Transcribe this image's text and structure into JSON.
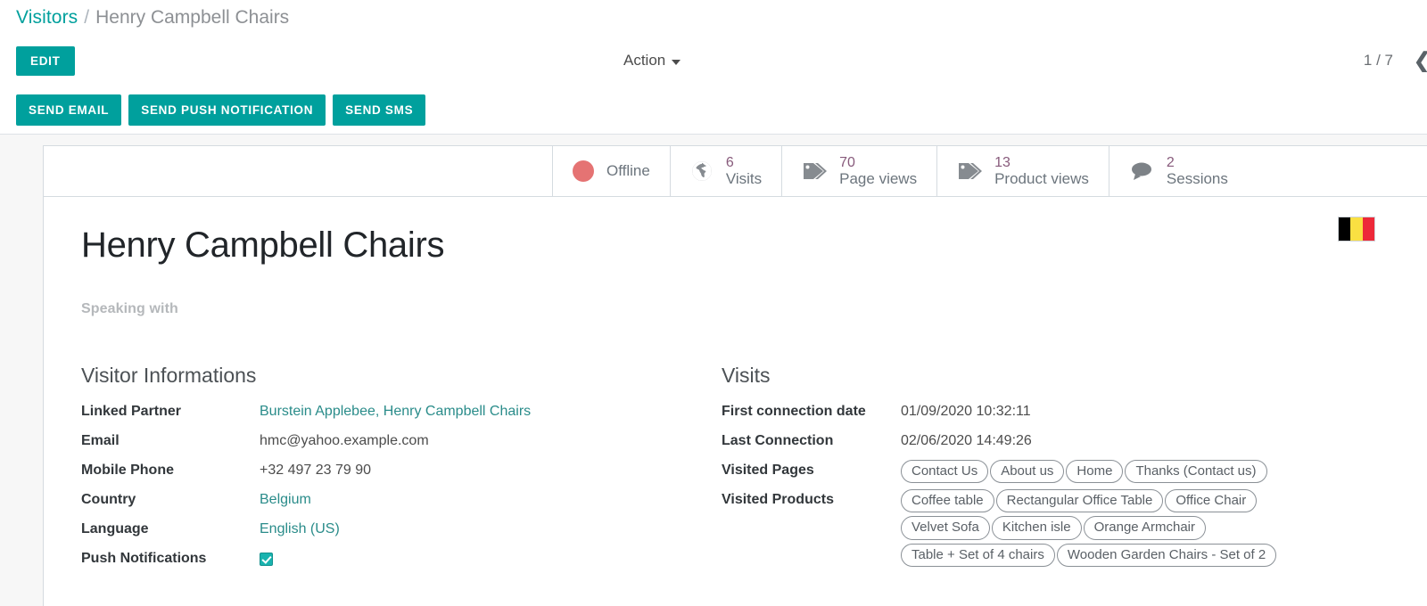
{
  "breadcrumb": {
    "root": "Visitors",
    "separator": "/",
    "current": "Henry Campbell Chairs"
  },
  "control_bar": {
    "edit_label": "EDIT",
    "action_label": "Action",
    "pager_count": "1 / 7",
    "pager_prev_glyph": "❮"
  },
  "action_bar": {
    "send_email": "SEND EMAIL",
    "send_push": "SEND PUSH NOTIFICATION",
    "send_sms": "SEND SMS"
  },
  "stats": {
    "status": {
      "label": "Offline",
      "color": "#e57373",
      "icon": "status-dot-icon"
    },
    "items": [
      {
        "icon": "globe-icon",
        "value": "6",
        "label": "Visits"
      },
      {
        "icon": "tags-icon",
        "value": "70",
        "label": "Page views"
      },
      {
        "icon": "tags-icon",
        "value": "13",
        "label": "Product views"
      },
      {
        "icon": "comment-icon",
        "value": "2",
        "label": "Sessions"
      }
    ]
  },
  "record": {
    "title": "Henry Campbell Chairs",
    "speaking_with_label": "Speaking with",
    "flag": {
      "name": "belgium-flag",
      "colors": [
        "#000000",
        "#FAE042",
        "#ED2939"
      ]
    }
  },
  "visitor_information": {
    "group_title": "Visitor Informations",
    "fields": [
      {
        "label": "Linked Partner",
        "value": "Burstein Applebee, Henry Campbell Chairs",
        "type": "link"
      },
      {
        "label": "Email",
        "value": "hmc@yahoo.example.com",
        "type": "text"
      },
      {
        "label": "Mobile Phone",
        "value": "+32 497 23 79 90",
        "type": "text"
      },
      {
        "label": "Country",
        "value": "Belgium",
        "type": "link"
      },
      {
        "label": "Language",
        "value": "English (US)",
        "type": "link"
      },
      {
        "label": "Push Notifications",
        "value": "",
        "type": "checkbox",
        "checked": true
      }
    ]
  },
  "visits": {
    "group_title": "Visits",
    "first_connection_label": "First connection date",
    "first_connection_value": "01/09/2020 10:32:11",
    "last_connection_label": "Last Connection",
    "last_connection_value": "02/06/2020 14:49:26",
    "visited_pages_label": "Visited Pages",
    "visited_pages": [
      "Contact Us",
      "About us",
      "Home",
      "Thanks (Contact us)"
    ],
    "visited_products_label": "Visited Products",
    "visited_products": [
      "Coffee table",
      "Rectangular Office Table",
      "Office Chair",
      "Velvet Sofa",
      "Kitchen isle",
      "Orange Armchair",
      "Table + Set of 4 chairs",
      "Wooden Garden Chairs - Set of 2"
    ]
  },
  "theme": {
    "accent": "#00a09d",
    "link": "#2a8c8a",
    "stat_number": "#875a7b"
  }
}
